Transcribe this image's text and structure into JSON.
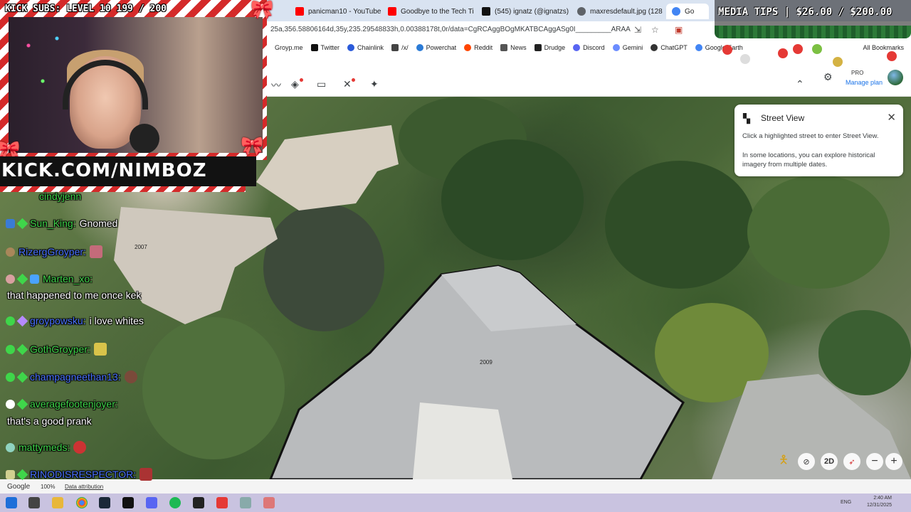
{
  "stream": {
    "subs_banner": "KICK SUBS: LEVEL 10 199 / 200",
    "kick_url": "KICK.COM/NIMBOZ",
    "media_tips": "MEDIA TIPS | $26.00 / $200.00"
  },
  "browser": {
    "tabs": [
      {
        "title": "panicman10 - YouTube",
        "icon": "youtube-icon",
        "color": "#ff0000"
      },
      {
        "title": "Goodbye to the Tech Ti",
        "icon": "youtube-icon",
        "color": "#ff0000"
      },
      {
        "title": "(545) ignatz (@ignatzs)",
        "icon": "x-icon",
        "color": "#111111"
      },
      {
        "title": "maxresdefault.jpg (128",
        "icon": "globe-icon",
        "color": "#5f6368"
      },
      {
        "title": "Go",
        "icon": "google-earth-icon",
        "color": "#4285f4"
      }
    ],
    "url": "25a,356.58806164d,35y,235.29548833h,0.00388178t,0r/data=CgRCAggBOgMKATBCAggASg0I_________ARAA",
    "bookmarks": [
      {
        "label": "Groyp.me",
        "color": "#888888"
      },
      {
        "label": "Twitter",
        "color": "#111111"
      },
      {
        "label": "Chainlink",
        "color": "#2a5ada"
      },
      {
        "label": "/x/",
        "color": "#444444"
      },
      {
        "label": "Powerchat",
        "color": "#2b7bd6"
      },
      {
        "label": "Reddit",
        "color": "#ff4500"
      },
      {
        "label": "News",
        "color": "#555555"
      },
      {
        "label": "Drudge",
        "color": "#222222"
      },
      {
        "label": "Discord",
        "color": "#5865f2"
      },
      {
        "label": "Gemini",
        "color": "#6b8cff"
      },
      {
        "label": "ChatGPT",
        "color": "#333333"
      },
      {
        "label": "Google Earth",
        "color": "#4285f4"
      }
    ],
    "all_bookmarks": "All Bookmarks"
  },
  "earth": {
    "plan": "PRO",
    "manage_plan": "Manage plan",
    "street_view": {
      "title": "Street View",
      "line1": "Click a highlighted street to enter Street View.",
      "line2": "In some locations, you can explore historical imagery from multiple dates."
    },
    "labels": {
      "a": "2007",
      "b": "2009"
    },
    "mode_2d": "2D",
    "footer": {
      "logo": "Google",
      "zoom": "100%",
      "attribution": "Data attribution"
    }
  },
  "chat": [
    {
      "user": "cindyjenn",
      "text": "",
      "color": "#3fd64a"
    },
    {
      "user": "Sun_King:",
      "text": "Gnomed",
      "color": "#3fd64a"
    },
    {
      "user": "RizergGroyper:",
      "text": "",
      "color": "#4a73ff"
    },
    {
      "user": "Marten_xo:",
      "text": "",
      "color": "#3fd64a"
    },
    {
      "user": "",
      "text": "that happened to me once kek",
      "color": "#ffffff"
    },
    {
      "user": "groypowsku:",
      "text": "i love whites",
      "color": "#4a73ff"
    },
    {
      "user": "GothGroyper:",
      "text": "",
      "color": "#3fd64a"
    },
    {
      "user": "champagneethan13:",
      "text": "",
      "color": "#4a73ff"
    },
    {
      "user": "averagefootenjoyer:",
      "text": "",
      "color": "#3fd64a"
    },
    {
      "user": "",
      "text": "that's a good prank",
      "color": "#ffffff"
    },
    {
      "user": "mattymeds:",
      "text": "",
      "color": "#3fd64a"
    },
    {
      "user": "RINODISRESPECTOR:",
      "text": "",
      "color": "#4a73ff"
    }
  ],
  "taskbar": {
    "lang": "ENG",
    "time": "2:40 AM",
    "date": "12/31/2025"
  }
}
